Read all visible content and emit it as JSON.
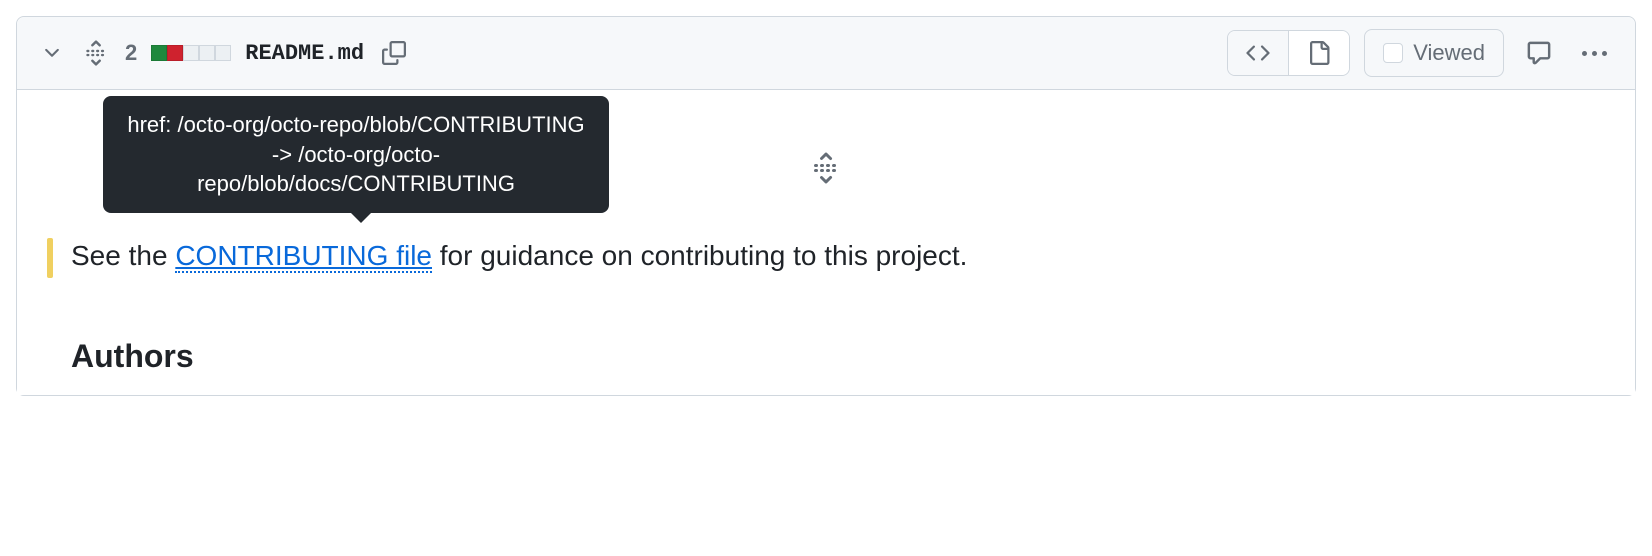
{
  "header": {
    "change_count": "2",
    "filename": "README.md",
    "viewed_label": "Viewed"
  },
  "tooltip": {
    "text": "href: /octo-org/octo-repo/blob/CONTRIBUTING -> /octo-org/octo-repo/blob/docs/CONTRIBUTING"
  },
  "body": {
    "text_before": "See the ",
    "link_text": "CONTRIBUTING file",
    "text_after": " for guidance on contributing to this project."
  },
  "heading": "Authors"
}
